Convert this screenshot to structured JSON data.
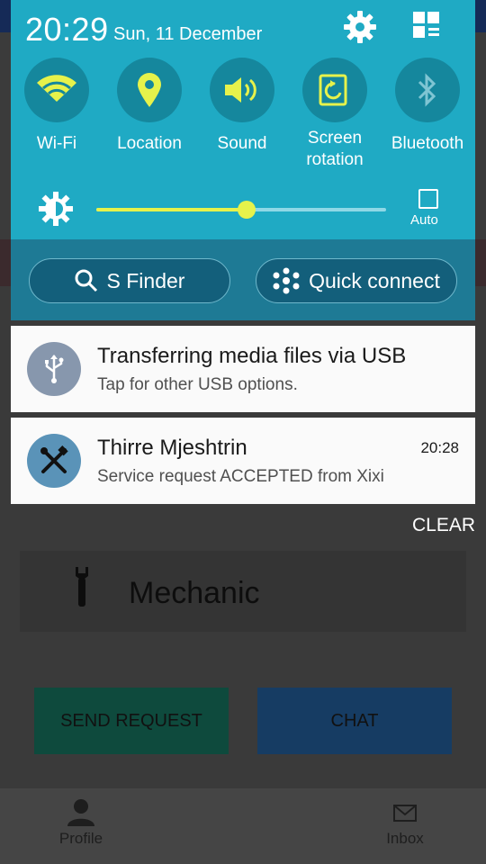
{
  "status": {
    "time": "20:29",
    "date": "Sun, 11 December"
  },
  "toggles": [
    {
      "label": "Wi-Fi",
      "icon": "wifi-icon",
      "active": true
    },
    {
      "label": "Location",
      "icon": "location-icon",
      "active": true
    },
    {
      "label": "Sound",
      "icon": "sound-icon",
      "active": true
    },
    {
      "label": "Screen rotation",
      "icon": "screen-rotation-icon",
      "active": true
    },
    {
      "label": "Bluetooth",
      "icon": "bluetooth-icon",
      "active": false
    }
  ],
  "brightness": {
    "level": 0.52,
    "auto_label": "Auto"
  },
  "actions": {
    "sfinder": "S Finder",
    "quick_connect": "Quick connect"
  },
  "notifications": [
    {
      "title": "Transferring media files via USB",
      "subtitle": "Tap for other USB options.",
      "icon": "usb-icon"
    },
    {
      "title": "Thirre Mjeshtrin",
      "subtitle": "Service request ACCEPTED from Xixi",
      "time": "20:28",
      "icon": "tools-icon"
    }
  ],
  "clear_label": "CLEAR",
  "app": {
    "service_title": "Mechanic",
    "send_request": "SEND REQUEST",
    "chat": "CHAT",
    "nav": {
      "profile": "Profile",
      "inbox": "Inbox"
    }
  },
  "colors": {
    "shade": "#1faac4",
    "toggle_active": "#e6f24b",
    "accent_send": "#0e4a3d",
    "accent_chat": "#163c63"
  }
}
